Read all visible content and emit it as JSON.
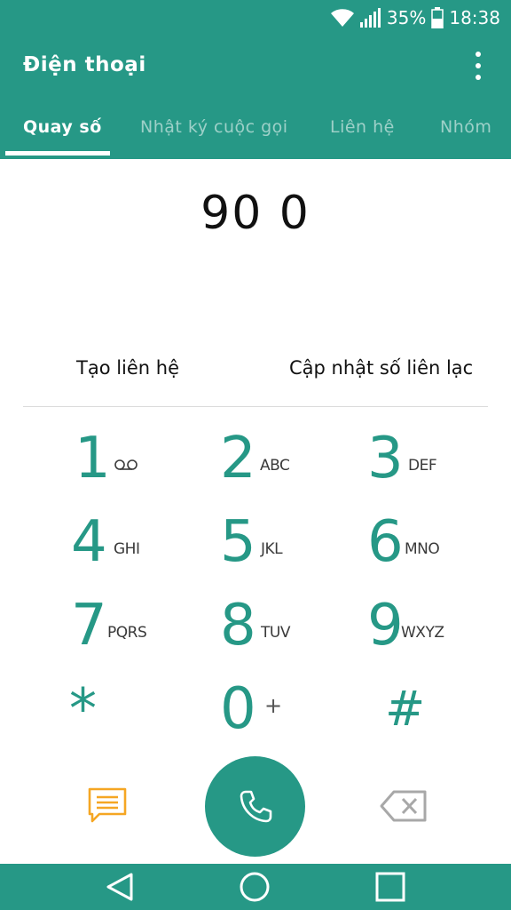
{
  "status": {
    "battery": "35%",
    "time": "18:38"
  },
  "app": {
    "title": "Điện thoại"
  },
  "tabs": [
    {
      "label": "Quay số"
    },
    {
      "label": "Nhật ký cuộc gọi"
    },
    {
      "label": "Liên hệ"
    },
    {
      "label": "Nhóm"
    }
  ],
  "dialed_number": "90 0",
  "actions": {
    "create_contact": "Tạo liên hệ",
    "update_contact": "Cập nhật số liên lạc"
  },
  "keypad": [
    {
      "digit": "1",
      "letters": ""
    },
    {
      "digit": "2",
      "letters": "ABC"
    },
    {
      "digit": "3",
      "letters": "DEF"
    },
    {
      "digit": "4",
      "letters": "GHI"
    },
    {
      "digit": "5",
      "letters": "JKL"
    },
    {
      "digit": "6",
      "letters": "MNO"
    },
    {
      "digit": "7",
      "letters": "PQRS"
    },
    {
      "digit": "8",
      "letters": "TUV"
    },
    {
      "digit": "9",
      "letters": "WXYZ"
    },
    {
      "digit": "*",
      "letters": ""
    },
    {
      "digit": "0",
      "letters": "+"
    },
    {
      "digit": "#",
      "letters": ""
    }
  ],
  "colors": {
    "primary": "#269886",
    "accent": "#f5a623"
  },
  "icons": {
    "voicemail": "voicemail-icon",
    "message": "message-icon",
    "call": "phone-icon",
    "backspace": "backspace-icon",
    "nav_back": "back-icon",
    "nav_home": "home-icon",
    "nav_recent": "recent-apps-icon"
  }
}
